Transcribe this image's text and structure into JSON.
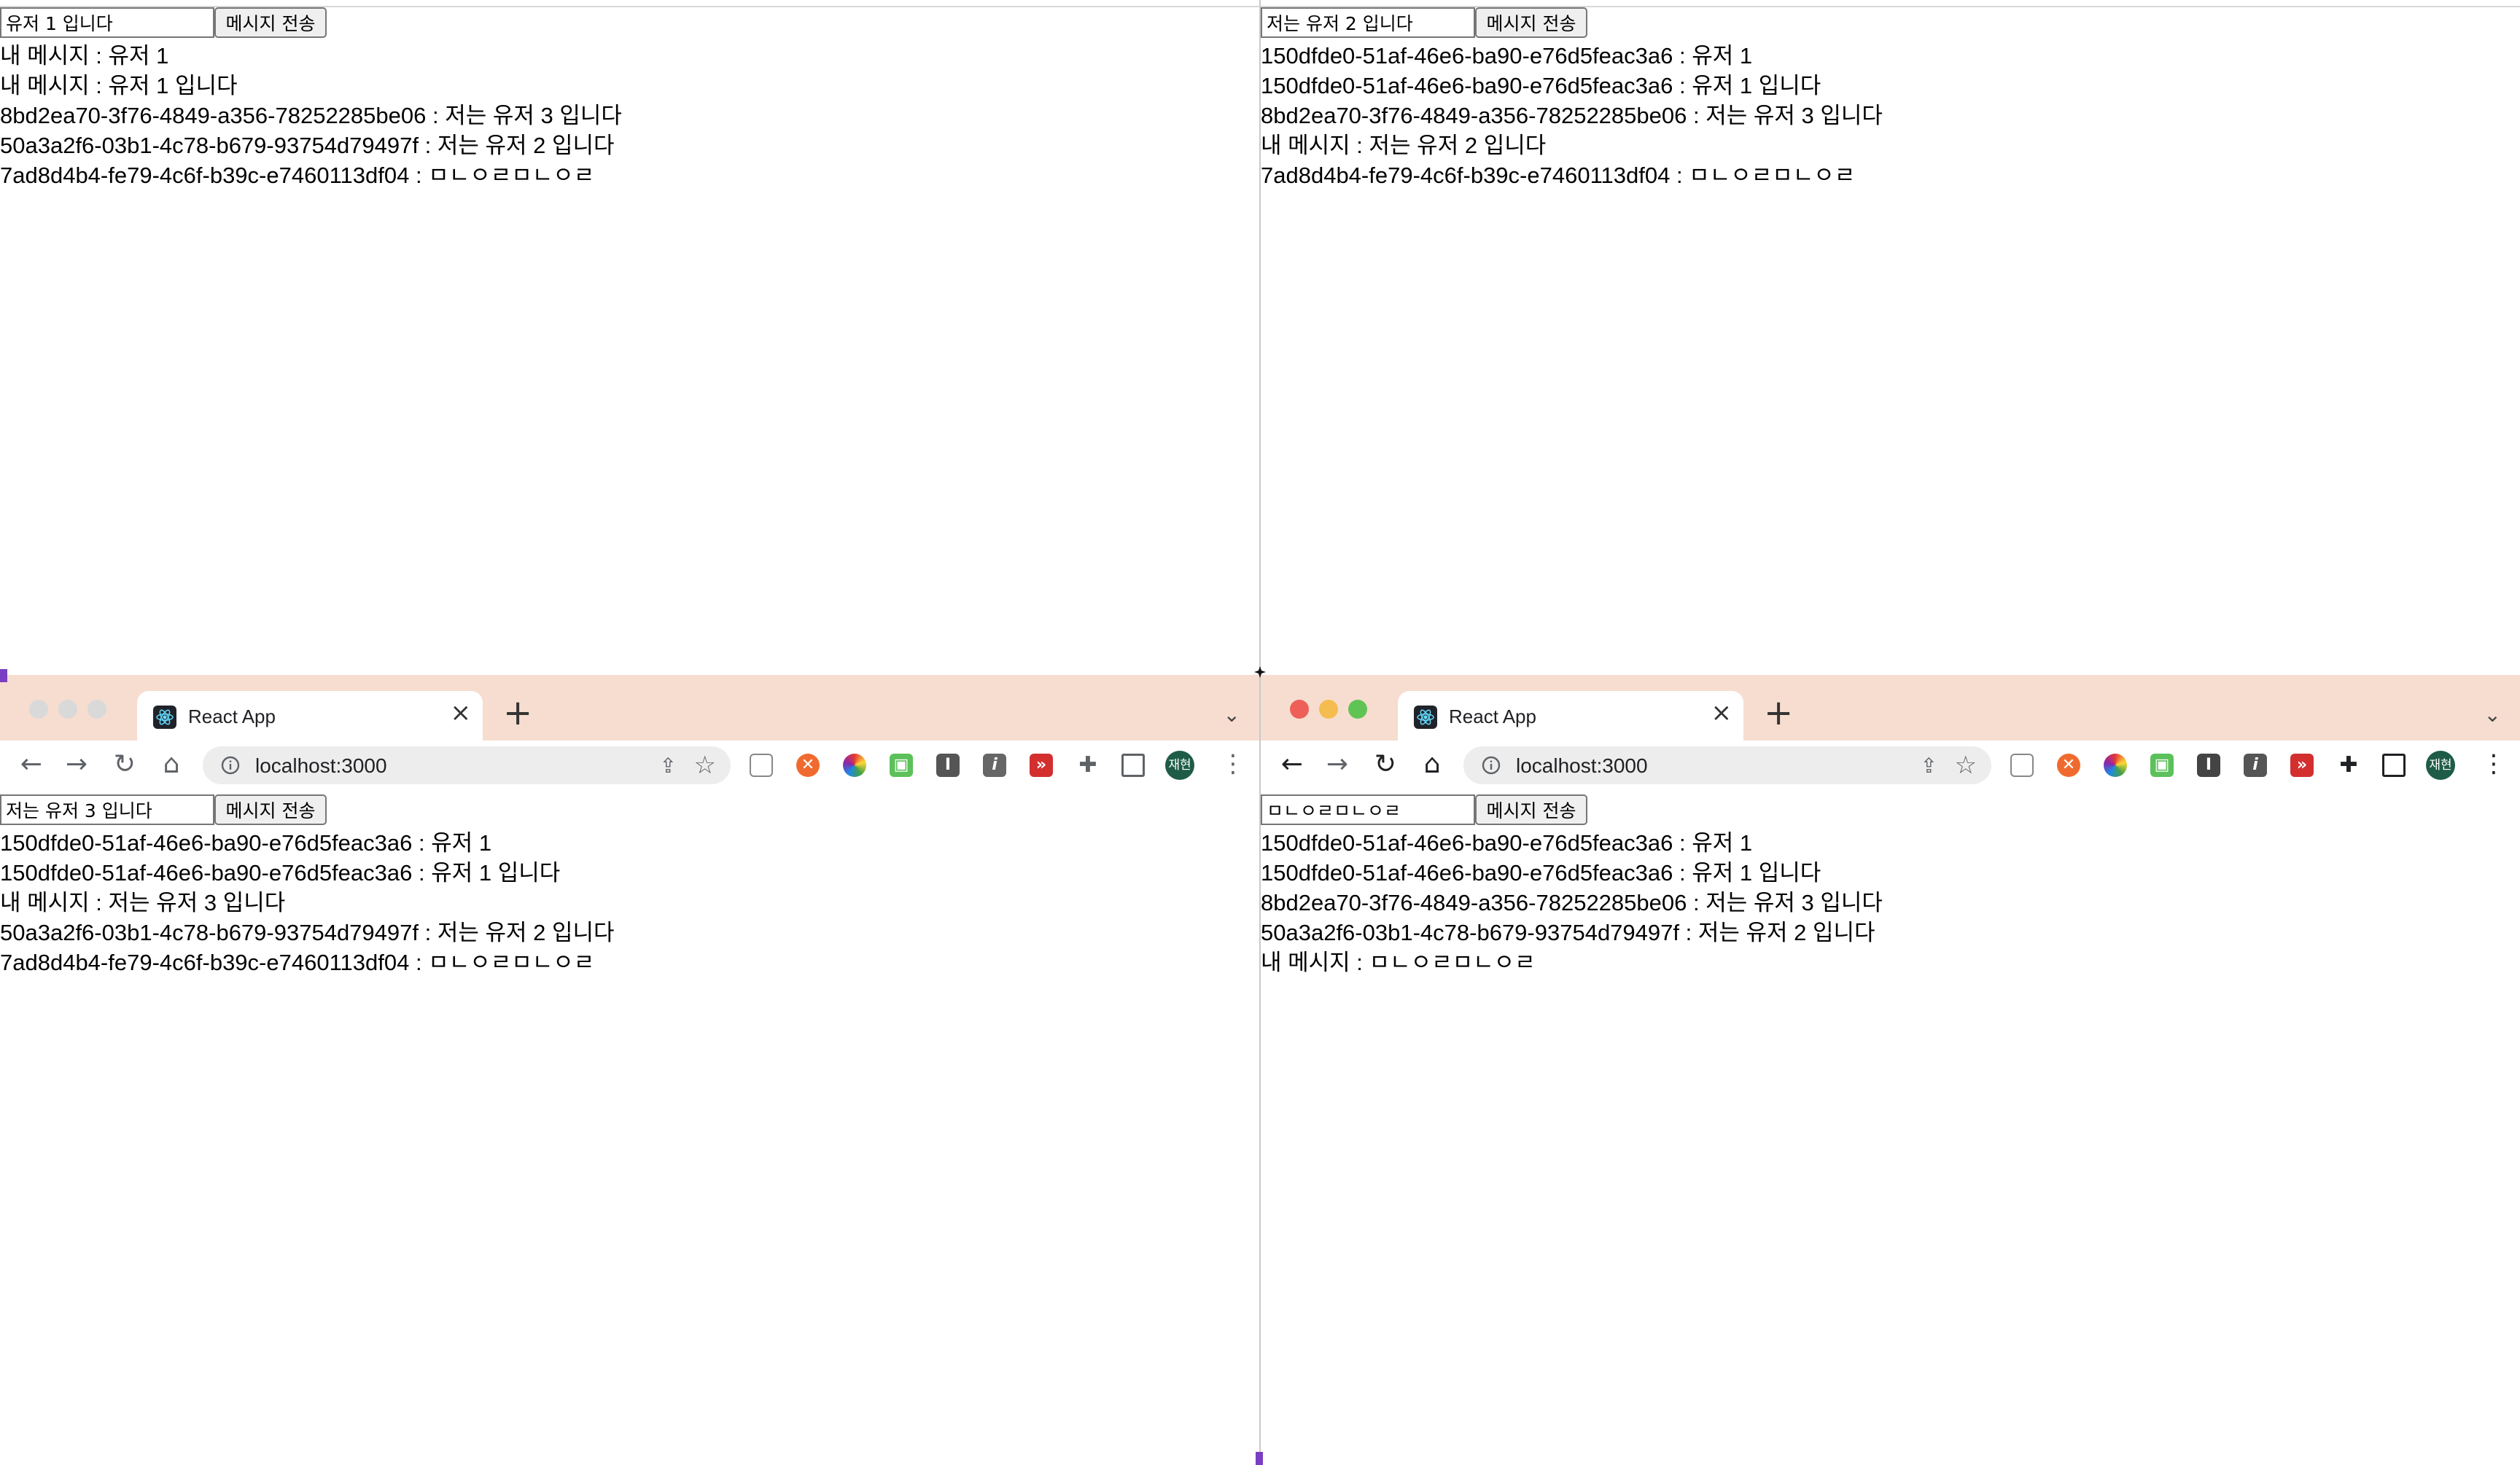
{
  "chrome": {
    "tab_title": "React App",
    "url": "localhost:3000",
    "profile_initials": "재현"
  },
  "windows": [
    {
      "input_value": "유저 1 입니다",
      "button_label": "메시지 전송",
      "messages": [
        "내 메시지 : 유저 1",
        "내 메시지 : 유저 1 입니다",
        "8bd2ea70-3f76-4849-a356-78252285be06 : 저는 유저 3 입니다",
        "50a3a2f6-03b1-4c78-b679-93754d79497f : 저는 유저 2 입니다",
        "7ad8d4b4-fe79-4c6f-b39c-e7460113df04 : ㅁㄴㅇㄹㅁㄴㅇㄹ"
      ]
    },
    {
      "input_value": "저는 유저 2 입니다",
      "button_label": "메시지 전송",
      "messages": [
        "150dfde0-51af-46e6-ba90-e76d5feac3a6 : 유저 1",
        "150dfde0-51af-46e6-ba90-e76d5feac3a6 : 유저 1 입니다",
        "8bd2ea70-3f76-4849-a356-78252285be06 : 저는 유저 3 입니다",
        "내 메시지 : 저는 유저 2 입니다",
        "7ad8d4b4-fe79-4c6f-b39c-e7460113df04 : ㅁㄴㅇㄹㅁㄴㅇㄹ"
      ]
    },
    {
      "input_value": "저는 유저 3 입니다",
      "button_label": "메시지 전송",
      "messages": [
        "150dfde0-51af-46e6-ba90-e76d5feac3a6 : 유저 1",
        "150dfde0-51af-46e6-ba90-e76d5feac3a6 : 유저 1 입니다",
        "내 메시지 : 저는 유저 3 입니다",
        "50a3a2f6-03b1-4c78-b679-93754d79497f : 저는 유저 2 입니다",
        "7ad8d4b4-fe79-4c6f-b39c-e7460113df04 : ㅁㄴㅇㄹㅁㄴㅇㄹ"
      ]
    },
    {
      "input_value": "ㅁㄴㅇㄹㅁㄴㅇㄹ",
      "button_label": "메시지 전송",
      "messages": [
        "150dfde0-51af-46e6-ba90-e76d5feac3a6 : 유저 1",
        "150dfde0-51af-46e6-ba90-e76d5feac3a6 : 유저 1 입니다",
        "8bd2ea70-3f76-4849-a356-78252285be06 : 저는 유저 3 입니다",
        "50a3a2f6-03b1-4c78-b679-93754d79497f : 저는 유저 2 입니다",
        "내 메시지 : ㅁㄴㅇㄹㅁㄴㅇㄹ"
      ]
    }
  ],
  "icons": {
    "back": "arrow-left-icon",
    "forward": "arrow-right-icon",
    "reload": "reload-icon",
    "home": "home-icon",
    "info": "info-icon",
    "share": "share-icon",
    "bookmark": "star-icon",
    "extensions": "puzzle-icon",
    "sidepanel": "side-panel-icon",
    "menu": "kebab-menu-icon"
  },
  "colors": {
    "tab_strip": "#f6ddd0",
    "omnibox": "#ededed",
    "avatar": "#1e5c48",
    "close_dot": "#ee5f57",
    "minimize_dot": "#f5bd4f",
    "zoom_dot": "#60c454",
    "inactive_dot": "#d9d9d9"
  }
}
